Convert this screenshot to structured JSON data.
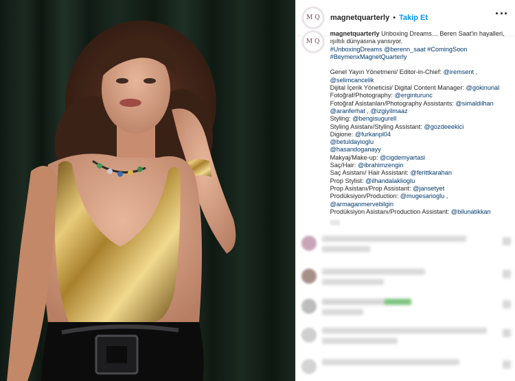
{
  "post": {
    "username": "magnetquarterly",
    "separator": "•",
    "follow_label": "Takip Et",
    "avatar_logo": "M Q",
    "photo_alt": "Beren Saat wearing a gold metallic bodysuit with jeweled necklace and gold cuff against a dark green velvet curtain"
  },
  "caption": {
    "username": "magnetquarterly",
    "line1": "Unboxing Dreams… Beren Saat'in hayalleri, ışıltılı dünyasına yansıyor.",
    "hashtags1": "#UnboxingDreams @berenn_saat #ComingSoon",
    "hashtags2": "#BeymenxMagnetQuarterly",
    "credits": [
      {
        "label": "Genel Yayın Yönetmeni/ Editor-in-Chief:",
        "handle": "@iremsent , @selimcancelik"
      },
      {
        "label": "Dijital İçerik Yöneticisi/ Digital Content Manager:",
        "handle": "@gokinunal"
      },
      {
        "label": "Fotoğraf/Photography:",
        "handle": "@erginturunc"
      },
      {
        "label": "Fotoğraf Asistanları/Photography Assistants:",
        "handle": "@simaldilhan"
      },
      {
        "label": "",
        "handle": "@aranferhat , @izgiyilmaaz"
      },
      {
        "label": "Styling:",
        "handle": "@bengisugurell"
      },
      {
        "label": "Styling Asistanı/Styling Assistant:",
        "handle": "@gozdeeekici"
      },
      {
        "label": "Digione:",
        "handle": "@furkanpl04"
      },
      {
        "label": "",
        "handle": "@betuldayioglu"
      },
      {
        "label": "",
        "handle": "@hasandoganayy"
      },
      {
        "label": "Makyaj/Make-up:",
        "handle": "@cigdemyartasi"
      },
      {
        "label": "Saç/Hair:",
        "handle": "@ibrahimzengin"
      },
      {
        "label": "Saç Asistanı/ Hair Assistant:",
        "handle": "@ferittkarahan"
      },
      {
        "label": "Prop Stylist:",
        "handle": "@ilhandalaklioglu"
      },
      {
        "label": "Prop Asistanı/Prop Assistant:",
        "handle": "@jansetyet"
      },
      {
        "label": "Prodüksiyon/Production:",
        "handle": "@mugesarioglu , @armaganmervebilgin"
      },
      {
        "label": "Prodüksiyon Asistanı/Production Assistant:",
        "handle": "@bilunatikkan"
      }
    ]
  },
  "colors": {
    "link": "#00376b",
    "follow": "#0095f6",
    "text": "#262626",
    "curtain": "#16241b",
    "gold": "#c9a24a"
  }
}
